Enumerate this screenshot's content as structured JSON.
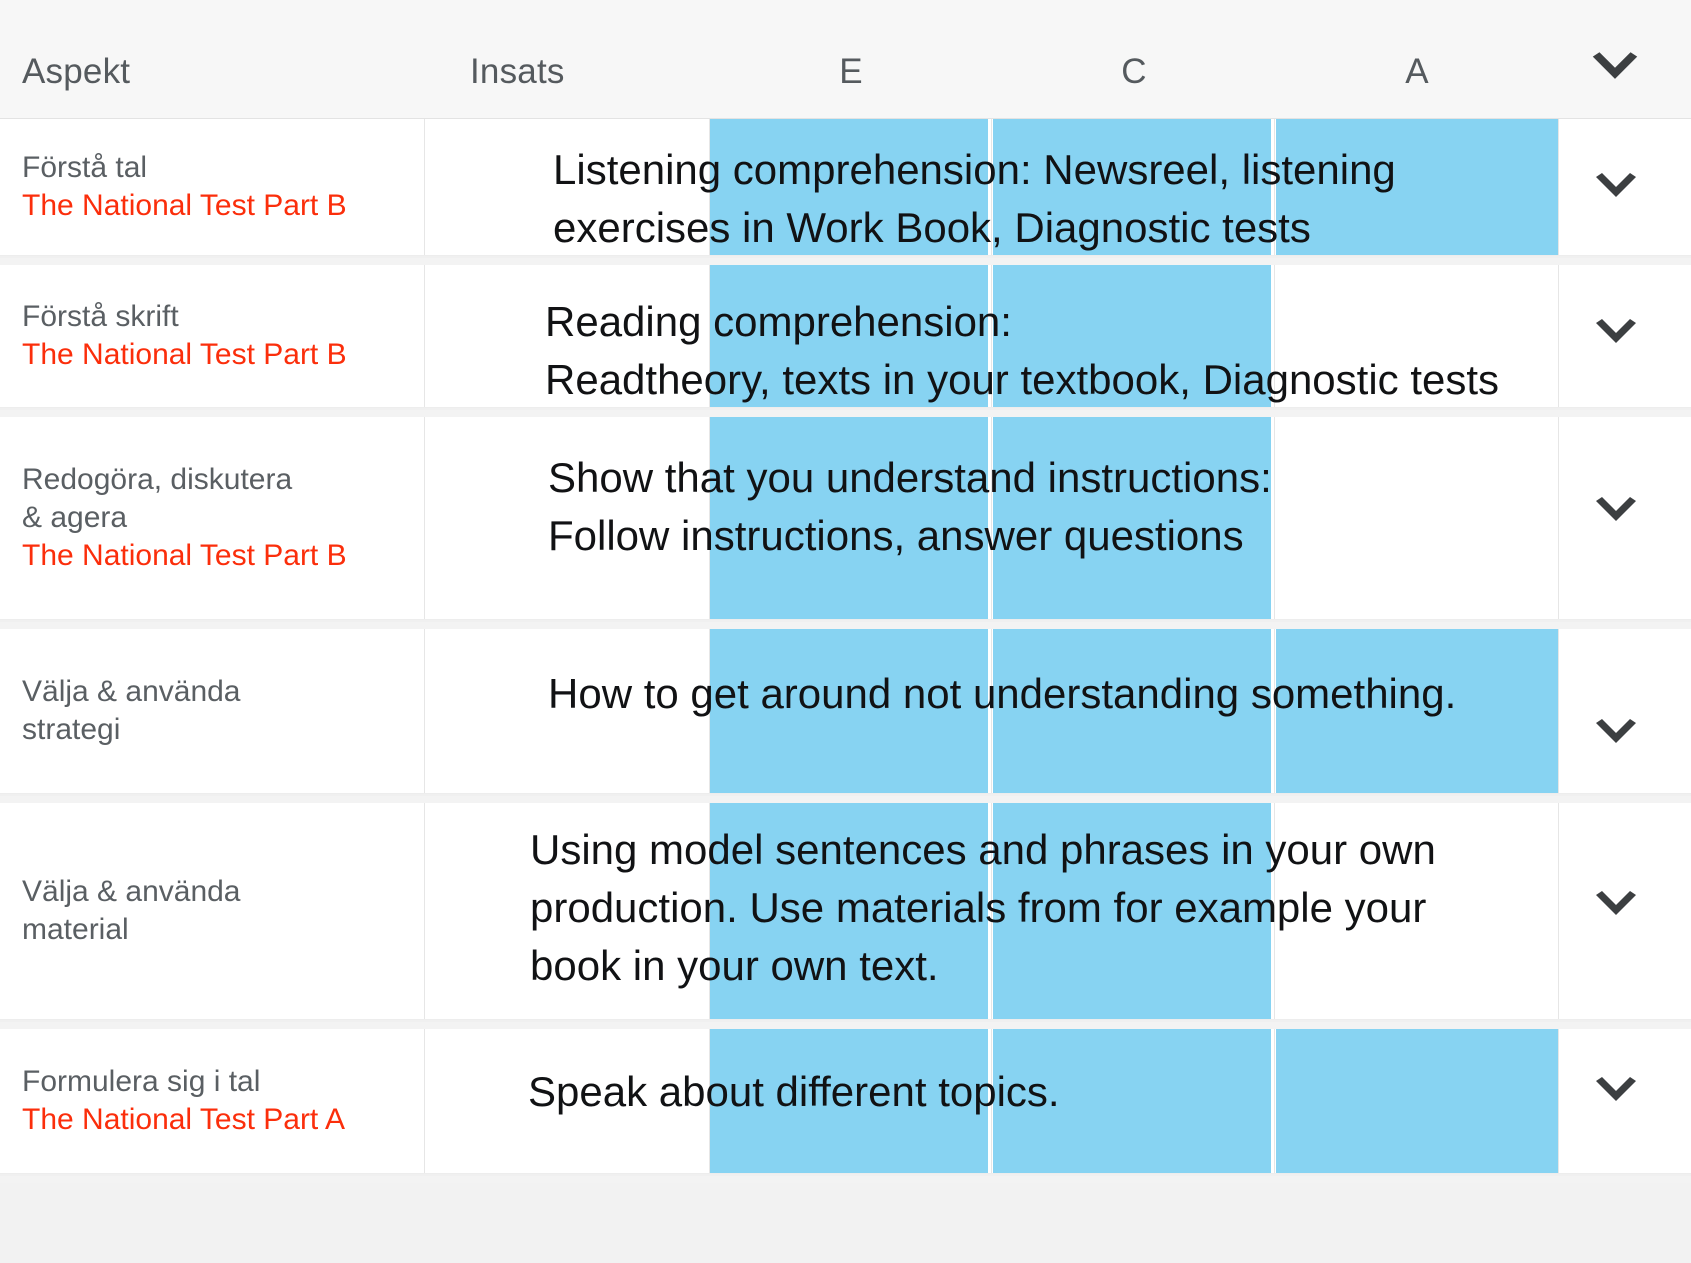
{
  "header": {
    "columns": [
      {
        "key": "aspekt",
        "label": "Aspekt"
      },
      {
        "key": "insats",
        "label": "Insats"
      },
      {
        "key": "e",
        "label": "E"
      },
      {
        "key": "c",
        "label": "C"
      },
      {
        "key": "a",
        "label": "A"
      }
    ],
    "aspekt_label": "Aspekt",
    "insats_label": "Insats",
    "e_label": "E",
    "c_label": "C",
    "a_label": "A",
    "expand_icon": "chevron-down-icon"
  },
  "colors": {
    "highlight": "#87d3f2",
    "subtitle_red": "#fb2e0b",
    "aspect_gray": "#5a5f63",
    "header_bg": "#f7f7f7",
    "row_bg": "#ffffff",
    "gap_bg": "#f3f3f3",
    "body_text": "#111214"
  },
  "rows": [
    {
      "aspect_title": "Förstå tal",
      "aspect_sub": "The National Test Part B",
      "insats_lines": [
        "Listening comprehension: Newsreel, listening",
        "exercises in Work Book, Diagnostic tests"
      ],
      "levels": {
        "e": true,
        "c": true,
        "a": true
      },
      "expand_icon": "chevron-down-icon"
    },
    {
      "aspect_title": "Förstå skrift",
      "aspect_sub": "The National Test Part B",
      "insats_lines": [
        "Reading comprehension:",
        "Readtheory, texts in your textbook, Diagnostic tests"
      ],
      "levels": {
        "e": true,
        "c": true,
        "a": false
      },
      "expand_icon": "chevron-down-icon"
    },
    {
      "aspect_title": "Redogöra, diskutera",
      "aspect_title2": "& agera",
      "aspect_sub": "The National Test Part B",
      "insats_lines": [
        "Show that you understand instructions:",
        "Follow instructions, answer questions"
      ],
      "levels": {
        "e": true,
        "c": true,
        "a": false
      },
      "expand_icon": "chevron-down-icon"
    },
    {
      "aspect_title": "Välja & använda",
      "aspect_title2": "strategi",
      "aspect_sub": "",
      "insats_lines": [
        "How to get around not understanding something."
      ],
      "levels": {
        "e": true,
        "c": true,
        "a": true
      },
      "expand_icon": "chevron-down-icon"
    },
    {
      "aspect_title": "Välja & använda",
      "aspect_title2": "material",
      "aspect_sub": "",
      "insats_lines": [
        "Using model sentences and phrases in your own",
        "production. Use materials from for example your",
        "book in your own text."
      ],
      "levels": {
        "e": true,
        "c": true,
        "a": false
      },
      "expand_icon": "chevron-down-icon"
    },
    {
      "aspect_title": "Formulera sig i tal",
      "aspect_sub": "The National Test Part A",
      "insats_lines": [
        "Speak about different topics."
      ],
      "levels": {
        "e": true,
        "c": true,
        "a": true
      },
      "expand_icon": "chevron-down-icon"
    }
  ]
}
